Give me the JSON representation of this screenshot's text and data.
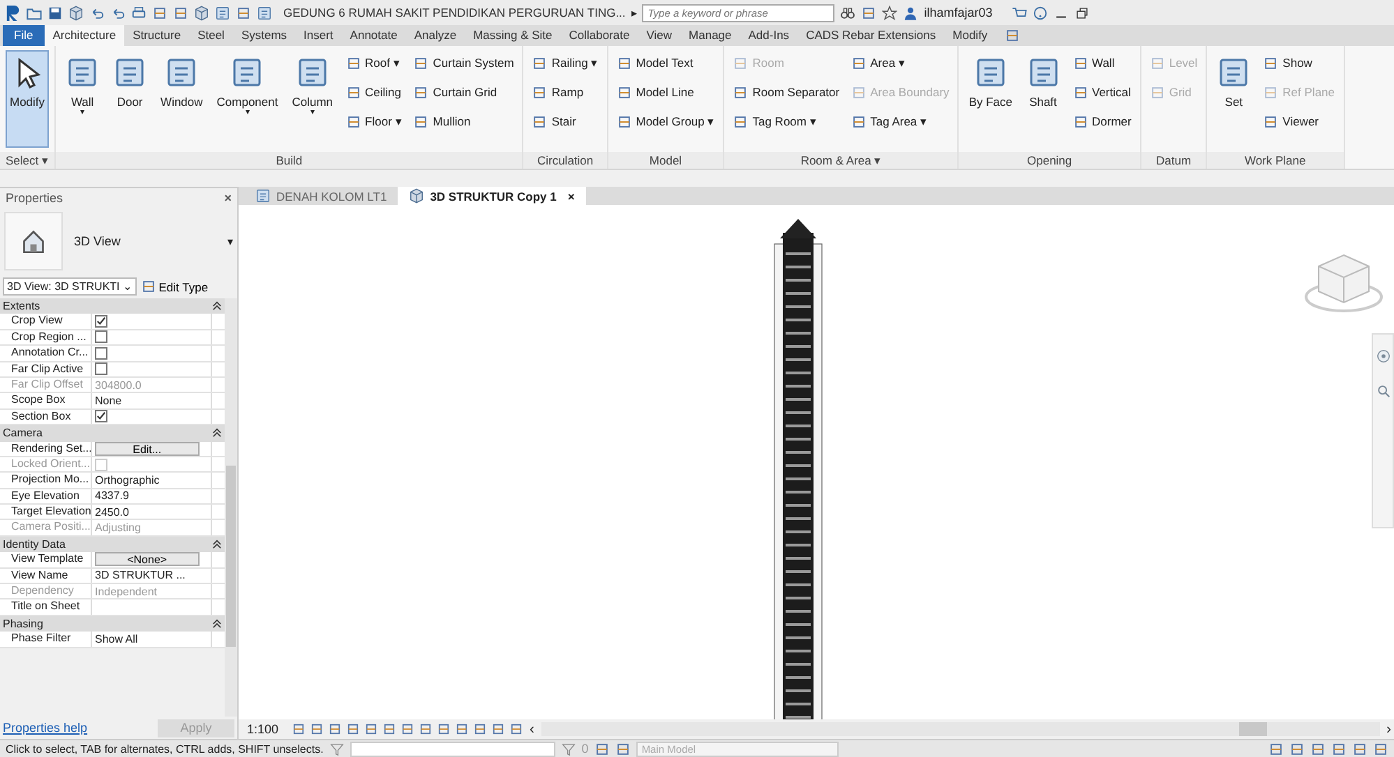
{
  "title_bar": {
    "title": "GEDUNG 6 RUMAH SAKIT PENDIDIKAN PERGURUAN TING...",
    "arrow": "▸",
    "search": {
      "placeholder": "Type a keyword or phrase"
    },
    "user": "ilhamfajar03"
  },
  "ribbon_tabs": [
    {
      "label": "File",
      "kind": "file",
      "selected": false
    },
    {
      "label": "Architecture",
      "kind": "tab",
      "selected": true
    },
    {
      "label": "Structure",
      "kind": "tab",
      "selected": false
    },
    {
      "label": "Steel",
      "kind": "tab",
      "selected": false
    },
    {
      "label": "Systems",
      "kind": "tab",
      "selected": false
    },
    {
      "label": "Insert",
      "kind": "tab",
      "selected": false
    },
    {
      "label": "Annotate",
      "kind": "tab",
      "selected": false
    },
    {
      "label": "Analyze",
      "kind": "tab",
      "selected": false
    },
    {
      "label": "Massing & Site",
      "kind": "tab",
      "selected": false
    },
    {
      "label": "Collaborate",
      "kind": "tab",
      "selected": false
    },
    {
      "label": "View",
      "kind": "tab",
      "selected": false
    },
    {
      "label": "Manage",
      "kind": "tab",
      "selected": false
    },
    {
      "label": "Add-Ins",
      "kind": "tab",
      "selected": false
    },
    {
      "label": "CADS Rebar Extensions",
      "kind": "tab",
      "selected": false
    },
    {
      "label": "Modify",
      "kind": "tab",
      "selected": false
    }
  ],
  "ribbon_panels": [
    {
      "title": "Select ▾",
      "items": [
        {
          "kind": "large",
          "label": "Modify",
          "selected": true
        }
      ]
    },
    {
      "title": "Build",
      "items": [
        {
          "kind": "large",
          "label": "Wall",
          "selected": false,
          "caret": "▾"
        },
        {
          "kind": "large",
          "label": "Door",
          "selected": false
        },
        {
          "kind": "large",
          "label": "Window",
          "selected": false
        },
        {
          "kind": "large",
          "label": "Component",
          "selected": false,
          "caret": "▾"
        },
        {
          "kind": "large",
          "label": "Column",
          "selected": false,
          "caret": "▾"
        },
        {
          "kind": "stack",
          "buttons": [
            {
              "label": "Roof ▾",
              "disabled": false
            },
            {
              "label": "Ceiling",
              "disabled": false
            },
            {
              "label": "Floor ▾",
              "disabled": false
            }
          ]
        },
        {
          "kind": "stack",
          "buttons": [
            {
              "label": "Curtain System",
              "disabled": false
            },
            {
              "label": "Curtain Grid",
              "disabled": false
            },
            {
              "label": "Mullion",
              "disabled": false
            }
          ]
        }
      ]
    },
    {
      "title": "Circulation",
      "items": [
        {
          "kind": "stack",
          "buttons": [
            {
              "label": "Railing ▾",
              "disabled": false
            },
            {
              "label": "Ramp",
              "disabled": false
            },
            {
              "label": "Stair",
              "disabled": false
            }
          ]
        }
      ]
    },
    {
      "title": "Model",
      "items": [
        {
          "kind": "stack",
          "buttons": [
            {
              "label": "Model Text",
              "disabled": false
            },
            {
              "label": "Model Line",
              "disabled": false
            },
            {
              "label": "Model Group ▾",
              "disabled": false
            }
          ]
        }
      ]
    },
    {
      "title": "Room & Area ▾",
      "items": [
        {
          "kind": "stack",
          "buttons": [
            {
              "label": "Room",
              "disabled": true
            },
            {
              "label": "Room Separator",
              "disabled": false
            },
            {
              "label": "Tag Room ▾",
              "disabled": false
            }
          ]
        },
        {
          "kind": "stack",
          "buttons": [
            {
              "label": "Area ▾",
              "disabled": false
            },
            {
              "label": "Area Boundary",
              "disabled": true
            },
            {
              "label": "Tag Area ▾",
              "disabled": false
            }
          ]
        }
      ]
    },
    {
      "title": "Opening",
      "items": [
        {
          "kind": "large",
          "label": "By Face",
          "selected": false
        },
        {
          "kind": "large",
          "label": "Shaft",
          "selected": false
        },
        {
          "kind": "stack",
          "buttons": [
            {
              "label": "Wall",
              "disabled": false
            },
            {
              "label": "Vertical",
              "disabled": false
            },
            {
              "label": "Dormer",
              "disabled": false
            }
          ]
        }
      ]
    },
    {
      "title": "Datum",
      "items": [
        {
          "kind": "stack",
          "buttons": [
            {
              "label": "Level",
              "disabled": true
            },
            {
              "label": "Grid",
              "disabled": true
            }
          ]
        }
      ]
    },
    {
      "title": "Work Plane",
      "items": [
        {
          "kind": "large",
          "label": "Set",
          "selected": false
        },
        {
          "kind": "stack",
          "buttons": [
            {
              "label": "Show",
              "disabled": false
            },
            {
              "label": "Ref Plane",
              "disabled": true
            },
            {
              "label": "Viewer",
              "disabled": false
            }
          ]
        }
      ]
    }
  ],
  "properties": {
    "title": "Properties",
    "close": "×",
    "type_name": "3D View",
    "type_caret": "▾",
    "instance": "3D View: 3D STRUKTI",
    "instance_caret": "⌄",
    "edit_type": "Edit Type",
    "groups": [
      {
        "title": "Extents",
        "rows": [
          {
            "name": "Crop View",
            "kind": "checkbox",
            "checked": true,
            "disabled": false
          },
          {
            "name": "Crop Region ...",
            "kind": "checkbox",
            "checked": false,
            "disabled": false
          },
          {
            "name": "Annotation Cr...",
            "kind": "checkbox",
            "checked": false,
            "disabled": false
          },
          {
            "name": "Far Clip Active",
            "kind": "checkbox",
            "checked": false,
            "disabled": false
          },
          {
            "name": "Far Clip Offset",
            "kind": "text",
            "value": "304800.0",
            "disabled": true
          },
          {
            "name": "Scope Box",
            "kind": "text",
            "value": "None",
            "disabled": false
          },
          {
            "name": "Section Box",
            "kind": "checkbox",
            "checked": true,
            "disabled": false
          }
        ]
      },
      {
        "title": "Camera",
        "rows": [
          {
            "name": "Rendering Set...",
            "kind": "button",
            "value": "Edit...",
            "disabled": false
          },
          {
            "name": "Locked Orient...",
            "kind": "checkbox",
            "checked": false,
            "disabled": true
          },
          {
            "name": "Projection Mo...",
            "kind": "text",
            "value": "Orthographic",
            "disabled": false
          },
          {
            "name": "Eye Elevation",
            "kind": "text",
            "value": "4337.9",
            "disabled": false
          },
          {
            "name": "Target Elevation",
            "kind": "text",
            "value": "2450.0",
            "disabled": false
          },
          {
            "name": "Camera Positi...",
            "kind": "text",
            "value": "Adjusting",
            "disabled": true
          }
        ]
      },
      {
        "title": "Identity Data",
        "rows": [
          {
            "name": "View Template",
            "kind": "button",
            "value": "<None>",
            "disabled": false
          },
          {
            "name": "View Name",
            "kind": "text",
            "value": "3D STRUKTUR ...",
            "disabled": false
          },
          {
            "name": "Dependency",
            "kind": "text",
            "value": "Independent",
            "disabled": true
          },
          {
            "name": "Title on Sheet",
            "kind": "text",
            "disabled": false
          }
        ]
      },
      {
        "title": "Phasing",
        "rows": [
          {
            "name": "Phase Filter",
            "kind": "text",
            "value": "Show All",
            "disabled": false
          }
        ]
      }
    ],
    "help": "Properties help",
    "apply": "Apply"
  },
  "view_tabs": [
    {
      "label": "DENAH KOLOM LT1",
      "selected": false
    },
    {
      "label": "3D STRUKTUR Copy 1",
      "selected": true,
      "close": "×"
    }
  ],
  "view_control": {
    "scale": "1:100",
    "scroll_left": "‹",
    "scroll_right": "›"
  },
  "status_bar": {
    "message": "Click to select, TAB for alternates, CTRL adds, SHIFT unselects.",
    "count": "0",
    "model": "Main Model"
  }
}
